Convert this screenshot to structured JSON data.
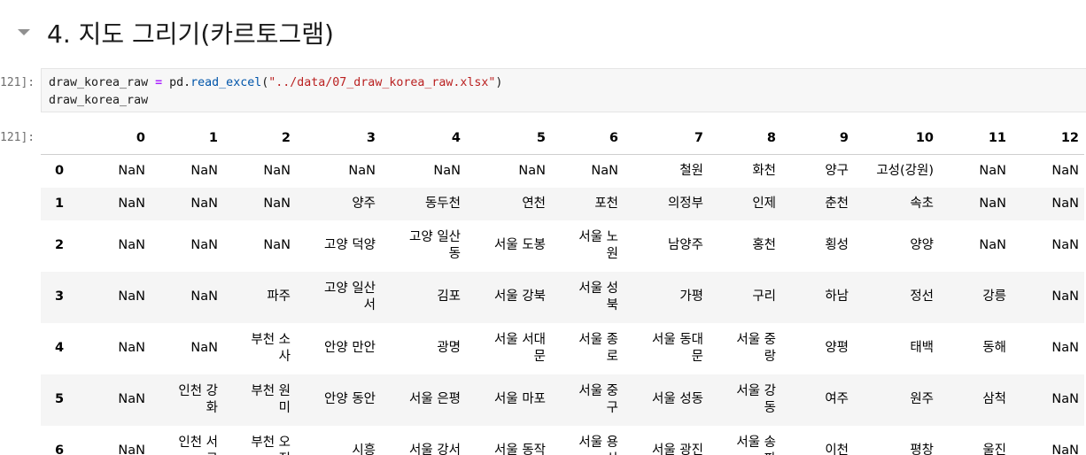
{
  "heading": "4. 지도 그리기(카르토그램)",
  "cell": {
    "in_prompt": "121]:",
    "out_prompt": "121]:",
    "code": {
      "line1_var": "draw_korea_raw",
      "line1_op": "=",
      "line1_obj": "pd.",
      "line1_func": "read_excel",
      "line1_open": "(",
      "line1_str": "\"../data/07_draw_korea_raw.xlsx\"",
      "line1_close": ")",
      "line2": "draw_korea_raw"
    }
  },
  "table": {
    "columns": [
      "0",
      "1",
      "2",
      "3",
      "4",
      "5",
      "6",
      "7",
      "8",
      "9",
      "10",
      "11",
      "12"
    ],
    "rows": [
      {
        "index": "0",
        "cells": [
          "NaN",
          "NaN",
          "NaN",
          "NaN",
          "NaN",
          "NaN",
          "NaN",
          "철원",
          "화천",
          "양구",
          "고성(강원)",
          "NaN",
          "NaN"
        ]
      },
      {
        "index": "1",
        "cells": [
          "NaN",
          "NaN",
          "NaN",
          "양주",
          "동두천",
          "연천",
          "포천",
          "의정부",
          "인제",
          "춘천",
          "속초",
          "NaN",
          "NaN"
        ]
      },
      {
        "index": "2",
        "cells": [
          "NaN",
          "NaN",
          "NaN",
          "고양 덕양",
          "고양 일산\n동",
          "서울 도봉",
          "서울 노\n원",
          "남양주",
          "홍천",
          "횡성",
          "양양",
          "NaN",
          "NaN"
        ]
      },
      {
        "index": "3",
        "cells": [
          "NaN",
          "NaN",
          "파주",
          "고양 일산\n서",
          "김포",
          "서울 강북",
          "서울 성\n북",
          "가평",
          "구리",
          "하남",
          "정선",
          "강릉",
          "NaN"
        ]
      },
      {
        "index": "4",
        "cells": [
          "NaN",
          "NaN",
          "부천 소\n사",
          "안양 만안",
          "광명",
          "서울 서대\n문",
          "서울 종\n로",
          "서울 동대\n문",
          "서울 중\n랑",
          "양평",
          "태백",
          "동해",
          "NaN"
        ]
      },
      {
        "index": "5",
        "cells": [
          "NaN",
          "인천 강\n화",
          "부천 원\n미",
          "안양 동안",
          "서울 은평",
          "서울 마포",
          "서울 중\n구",
          "서울 성동",
          "서울 강\n동",
          "여주",
          "원주",
          "삼척",
          "NaN"
        ]
      },
      {
        "index": "6",
        "cells": [
          "NaN",
          "인천 서\n구",
          "부천 오\n정",
          "시흥",
          "서울 강서",
          "서울 동작",
          "서울 용\n산",
          "서울 광진",
          "서울 송\n파",
          "이천",
          "평창",
          "울진",
          "NaN"
        ]
      }
    ]
  }
}
